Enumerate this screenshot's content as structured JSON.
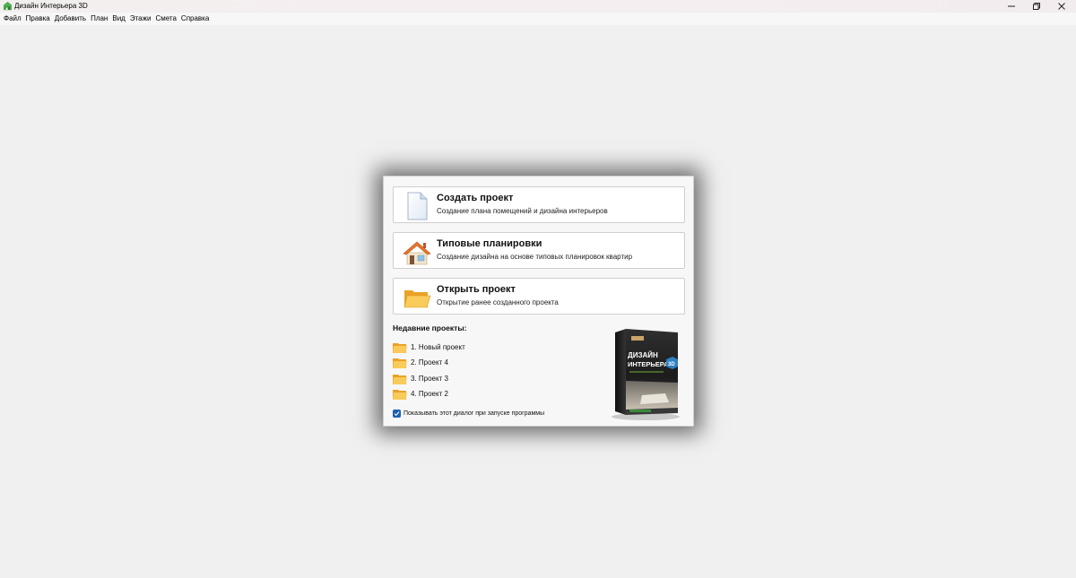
{
  "window": {
    "title": "Дизайн Интерьера 3D"
  },
  "menu": [
    "Файл",
    "Правка",
    "Добавить",
    "План",
    "Вид",
    "Этажи",
    "Смета",
    "Справка"
  ],
  "dialog": {
    "actions": [
      {
        "title": "Создать проект",
        "description": "Создание плана помещений и дизайна интерьеров",
        "icon": "blank-document-icon"
      },
      {
        "title": "Типовые планировки",
        "description": "Создание дизайна на основе типовых планировок квартир",
        "icon": "house-icon"
      },
      {
        "title": "Открыть проект",
        "description": "Открытие ранее созданного проекта",
        "icon": "open-folder-icon"
      }
    ],
    "recent_heading": "Недавние проекты:",
    "recent_projects": [
      "1. Новый проект",
      "2. Проект 4",
      "3. Проект 3",
      "4. Проект 2"
    ],
    "show_on_startup": {
      "label": "Показывать этот диалог при запуске программы",
      "checked": true
    },
    "product_box": {
      "line1": "ДИЗАЙН",
      "line2": "ИНТЕРЬЕРА",
      "badge": "3D"
    }
  },
  "colors": {
    "background": "#f0f0f0",
    "dialog_bg": "#f7f7f7",
    "card_bg": "#ffffff",
    "checkbox": "#1f5fb0",
    "folder": "#f5b83a"
  }
}
